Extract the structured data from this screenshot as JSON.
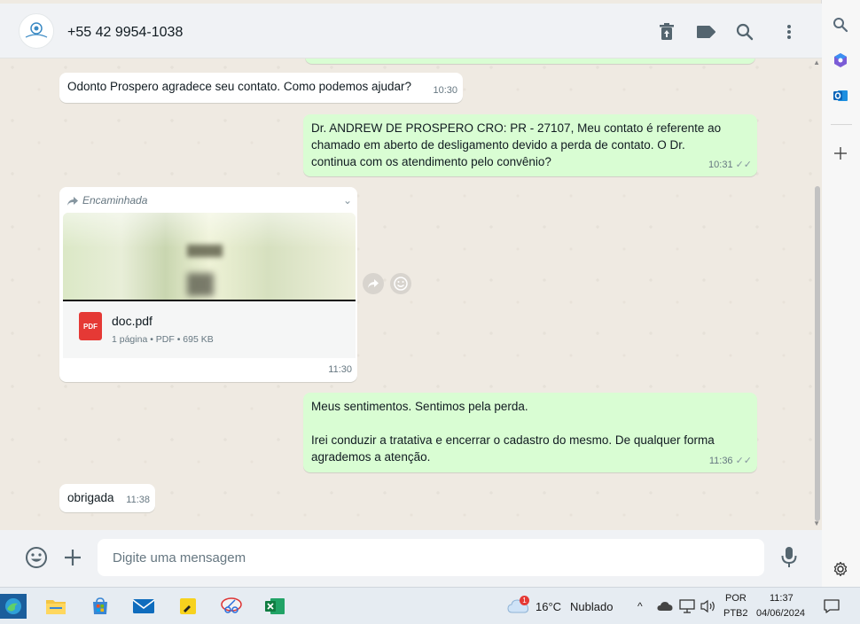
{
  "header": {
    "contact_name": "+55 42 9954-1038",
    "icons": [
      "delete-icon",
      "label-icon",
      "search-icon",
      "menu-icon"
    ]
  },
  "messages": [
    {
      "direction": "in",
      "text": "Odonto Prospero agradece seu contato. Como podemos ajudar?",
      "time": "10:30"
    },
    {
      "direction": "out",
      "lines": [
        "Dr. ANDREW DE PROSPERO CRO: PR - 27107, Meu contato é referente ao",
        "chamado em aberto de desligamento devido a perda de contato. O Dr.",
        "continua com os atendimento pelo convênio?"
      ],
      "time": "10:31",
      "status": "read"
    },
    {
      "direction": "in",
      "forwarded_label": "Encaminhada",
      "doc_name": "doc.pdf",
      "doc_meta": "1 página • PDF • 695 KB",
      "doc_type": "PDF",
      "time": "11:30"
    },
    {
      "direction": "out",
      "lines": [
        "Meus sentimentos. Sentimos pela perda.",
        "",
        "Irei conduzir a tratativa e encerrar o cadastro do mesmo. De qualquer forma",
        "agrademos a atenção."
      ],
      "time": "11:36",
      "status": "read"
    },
    {
      "direction": "in",
      "text": "obrigada",
      "time": "11:38"
    }
  ],
  "composer": {
    "placeholder": "Digite uma mensagem"
  },
  "taskbar": {
    "weather_temp": "16°C",
    "weather_desc": "Nublado",
    "weather_badge": "1",
    "lang_top": "POR",
    "lang_bottom": "PTB2",
    "clock_time": "11:37",
    "clock_date": "04/06/2024"
  },
  "colors": {
    "outgoing_bubble": "#d9fdd3",
    "incoming_bubble": "#ffffff",
    "chat_bg": "#efeae2",
    "pdf_red": "#e53935"
  }
}
